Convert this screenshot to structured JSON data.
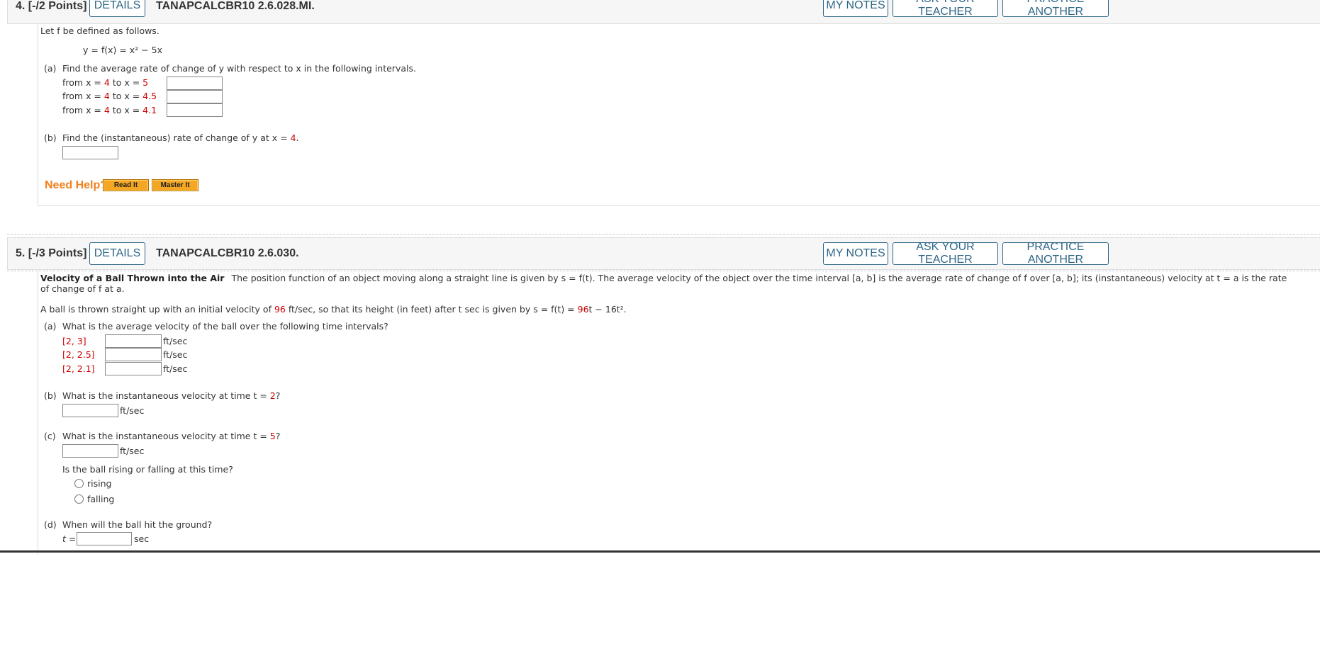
{
  "q4": {
    "points": "4. [-/2 Points]",
    "details": "DETAILS",
    "code": "TANAPCALCBR10 2.6.028.MI.",
    "my_notes": "MY NOTES",
    "ask_teacher": "ASK YOUR TEACHER",
    "practice_another": "PRACTICE ANOTHER",
    "intro": "Let f be defined as follows.",
    "function": "y = f(x) = x² − 5x",
    "part_a_label": "(a)",
    "part_a_text": "Find the average rate of change of y with respect to x in the following intervals.",
    "intervals": [
      {
        "prefix": "from x = ",
        "a": "4",
        "mid": " to x = ",
        "b": "5"
      },
      {
        "prefix": "from x = ",
        "a": "4",
        "mid": " to x = ",
        "b": "4.5"
      },
      {
        "prefix": "from x = ",
        "a": "4",
        "mid": " to x = ",
        "b": "4.1"
      }
    ],
    "part_b_label": "(b)",
    "part_b_text": "Find the (instantaneous) rate of change of y at x = ",
    "part_b_value": "4",
    "need_help": "Need Help?",
    "read_it": "Read It",
    "master_it": "Master It"
  },
  "q5": {
    "points": "5. [-/3 Points]",
    "details": "DETAILS",
    "code": "TANAPCALCBR10 2.6.030.",
    "my_notes": "MY NOTES",
    "ask_teacher": "ASK YOUR TEACHER",
    "practice_another": "PRACTICE ANOTHER",
    "title": "Velocity of a Ball Thrown into the Air",
    "intro_line1": "The position function of an object moving along a straight line is given by s = f(t). The average velocity of the object over the time interval [a, b] is the average rate of change of f over [a, b]; its (instantaneous) velocity at t = a is the rate",
    "intro_line2": "of change of f at a.",
    "ball_pre": "A ball is thrown straight up with an initial velocity of ",
    "ball_v": "96",
    "ball_mid": " ft/sec, so that its height (in feet) after t sec is given by s = f(t) = ",
    "ball_coef": "96",
    "ball_end": "t − 16t².",
    "part_a_label": "(a)",
    "part_a_text": "What is the average velocity of the ball over the following time intervals?",
    "intervals": [
      "[2, 3]",
      "[2, 2.5]",
      "[2, 2.1]"
    ],
    "unit": "ft/sec",
    "part_b_label": "(b)",
    "part_b_text": "What is the instantaneous velocity at time t = ",
    "part_b_value": "2",
    "part_c_label": "(c)",
    "part_c_text": "What is the instantaneous velocity at time t = ",
    "part_c_value": "5",
    "rising_q": "Is the ball rising or falling at this time?",
    "rising": "rising",
    "falling": "falling",
    "part_d_label": "(d)",
    "part_d_text": "When will the ball hit the ground?",
    "t_eq": "t =",
    "sec": "sec"
  }
}
